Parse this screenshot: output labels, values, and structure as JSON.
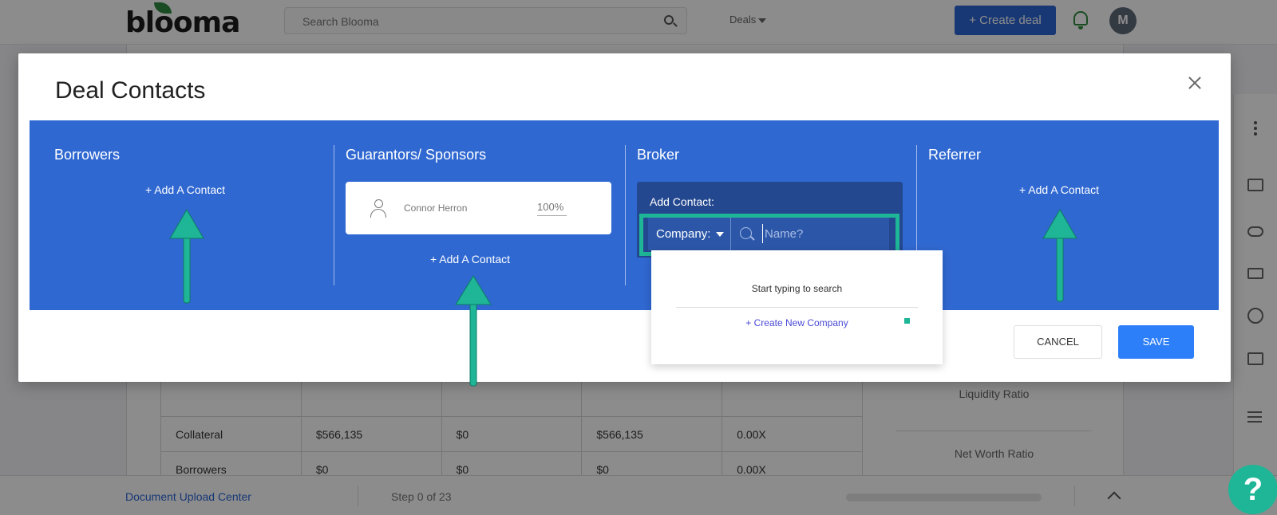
{
  "app": {
    "logo": "blooma",
    "search_placeholder": "Search Blooma",
    "deals_menu": "Deals",
    "create_deal": "+ Create deal",
    "avatar_initial": "M"
  },
  "background": {
    "rows": [
      {
        "label": "Collateral",
        "c1": "$566,135",
        "c2": "$0",
        "c3": "$566,135",
        "c4": "0.00X"
      },
      {
        "label": "Borrowers",
        "c1": "$0",
        "c2": "$0",
        "c3": "$0",
        "c4": "0.00X"
      }
    ],
    "ratios": [
      "Liquidity Ratio",
      "Net Worth Ratio"
    ]
  },
  "footer": {
    "link": "Document Upload Center",
    "step": "Step 0 of 23",
    "progress": 0,
    "help": "?"
  },
  "modal": {
    "title": "Deal Contacts",
    "columns": {
      "borrowers": {
        "title": "Borrowers",
        "add": "+ Add A Contact"
      },
      "guarantors": {
        "title": "Guarantors/ Sponsors",
        "contact_name": "Connor Herron",
        "contact_pct": "100%",
        "add": "+ Add A Contact"
      },
      "broker": {
        "title": "Broker",
        "add_label": "Add Contact:",
        "select_value": "Company:",
        "name_placeholder": "Name?"
      },
      "referrer": {
        "title": "Referrer",
        "add": "+ Add A Contact"
      }
    },
    "dropdown": {
      "hint": "Start typing to search",
      "create": "+ Create New Company"
    },
    "cancel": "CANCEL",
    "save": "SAVE"
  },
  "colors": {
    "band": "#3068d1",
    "highlight": "#1fb597",
    "primary": "#2d66d6"
  }
}
